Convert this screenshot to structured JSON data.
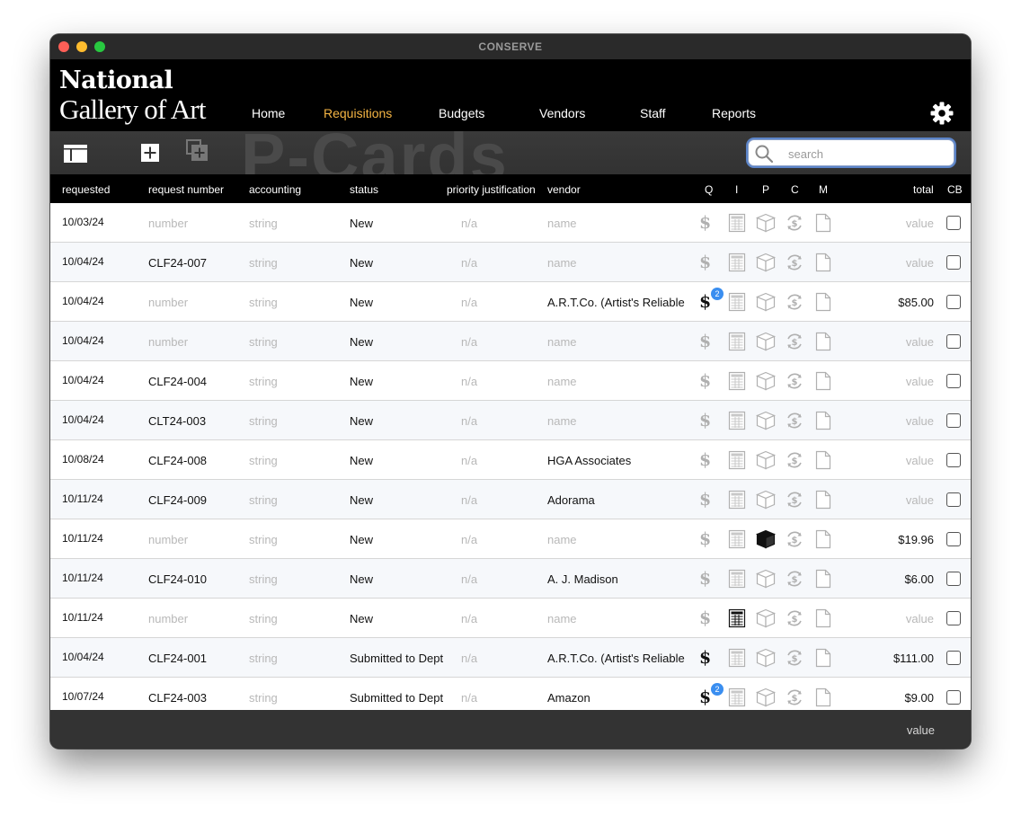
{
  "window": {
    "title": "CONSERVE"
  },
  "logo": {
    "line1": "National",
    "line2": "Gallery of Art"
  },
  "nav": [
    {
      "label": "Home",
      "active": false
    },
    {
      "label": "Requisitions",
      "active": true
    },
    {
      "label": "Budgets",
      "active": false
    },
    {
      "label": "Vendors",
      "active": false
    },
    {
      "label": "Staff",
      "active": false
    },
    {
      "label": "Reports",
      "active": false
    }
  ],
  "toolbar": {
    "watermark": "P-Cards",
    "search_placeholder": "search"
  },
  "columns": {
    "requested": "requested",
    "request_number": "request number",
    "accounting": "accounting",
    "status": "status",
    "priority": "priority justification",
    "vendor": "vendor",
    "q": "Q",
    "i": "I",
    "p": "P",
    "c": "C",
    "m": "M",
    "total": "total",
    "cb": "CB"
  },
  "rows": [
    {
      "date": "10/03/24",
      "req": "number",
      "acct": "string",
      "status": "New",
      "prio": "n/a",
      "vendor": "name",
      "total": "value",
      "q_on": false,
      "q_badge": "",
      "i_on": false,
      "p_on": false
    },
    {
      "date": "10/04/24",
      "req": "CLF24-007",
      "acct": "string",
      "status": "New",
      "prio": "n/a",
      "vendor": "name",
      "total": "value",
      "q_on": false,
      "q_badge": "",
      "i_on": false,
      "p_on": false
    },
    {
      "date": "10/04/24",
      "req": "number",
      "acct": "string",
      "status": "New",
      "prio": "n/a",
      "vendor": "A.R.T.Co. (Artist's Reliable",
      "total": "$85.00",
      "q_on": true,
      "q_badge": "2",
      "i_on": false,
      "p_on": false
    },
    {
      "date": "10/04/24",
      "req": "number",
      "acct": "string",
      "status": "New",
      "prio": "n/a",
      "vendor": "name",
      "total": "value",
      "q_on": false,
      "q_badge": "",
      "i_on": false,
      "p_on": false
    },
    {
      "date": "10/04/24",
      "req": "CLF24-004",
      "acct": "string",
      "status": "New",
      "prio": "n/a",
      "vendor": "name",
      "total": "value",
      "q_on": false,
      "q_badge": "",
      "i_on": false,
      "p_on": false
    },
    {
      "date": "10/04/24",
      "req": "CLT24-003",
      "acct": "string",
      "status": "New",
      "prio": "n/a",
      "vendor": "name",
      "total": "value",
      "q_on": false,
      "q_badge": "",
      "i_on": false,
      "p_on": false
    },
    {
      "date": "10/08/24",
      "req": "CLF24-008",
      "acct": "string",
      "status": "New",
      "prio": "n/a",
      "vendor": "HGA Associates",
      "total": "value",
      "q_on": false,
      "q_badge": "",
      "i_on": false,
      "p_on": false
    },
    {
      "date": "10/11/24",
      "req": "CLF24-009",
      "acct": "string",
      "status": "New",
      "prio": "n/a",
      "vendor": "Adorama",
      "total": "value",
      "q_on": false,
      "q_badge": "",
      "i_on": false,
      "p_on": false
    },
    {
      "date": "10/11/24",
      "req": "number",
      "acct": "string",
      "status": "New",
      "prio": "n/a",
      "vendor": "name",
      "total": "$19.96",
      "q_on": false,
      "q_badge": "",
      "i_on": false,
      "p_on": true
    },
    {
      "date": "10/11/24",
      "req": "CLF24-010",
      "acct": "string",
      "status": "New",
      "prio": "n/a",
      "vendor": "A. J. Madison",
      "total": "$6.00",
      "q_on": false,
      "q_badge": "",
      "i_on": false,
      "p_on": false
    },
    {
      "date": "10/11/24",
      "req": "number",
      "acct": "string",
      "status": "New",
      "prio": "n/a",
      "vendor": "name",
      "total": "value",
      "q_on": false,
      "q_badge": "",
      "i_on": true,
      "p_on": false
    },
    {
      "date": "10/04/24",
      "req": "CLF24-001",
      "acct": "string",
      "status": "Submitted to Dept",
      "prio": "n/a",
      "vendor": "A.R.T.Co. (Artist's Reliable",
      "total": "$111.00",
      "q_on": true,
      "q_badge": "",
      "i_on": false,
      "p_on": false
    },
    {
      "date": "10/07/24",
      "req": "CLF24-003",
      "acct": "string",
      "status": "Submitted to Dept",
      "prio": "n/a",
      "vendor": "Amazon",
      "total": "$9.00",
      "q_on": true,
      "q_badge": "2",
      "i_on": false,
      "p_on": false
    }
  ],
  "footer": {
    "total": "value"
  },
  "colors": {
    "accent": "#f5b544",
    "badge": "#3a8ef0",
    "icon_off": "#b0b0b0",
    "icon_on": "#111111"
  }
}
